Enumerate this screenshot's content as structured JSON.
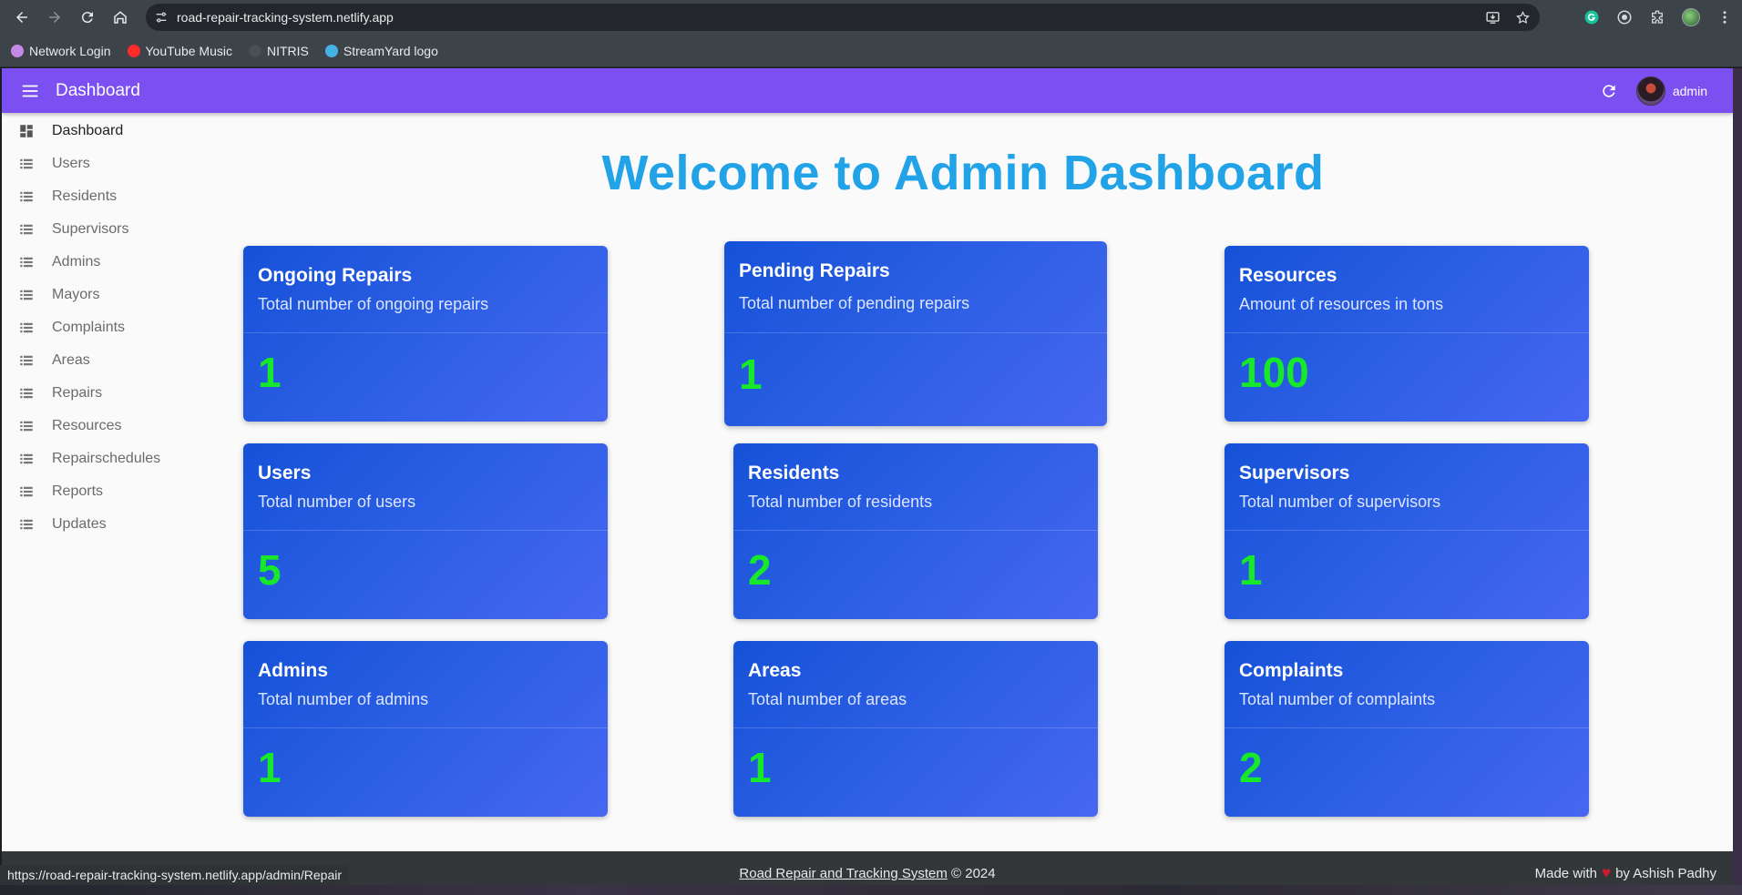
{
  "browser": {
    "url": "road-repair-tracking-system.netlify.app",
    "status_url": "https://road-repair-tracking-system.netlify.app/admin/Repair",
    "bookmarks": [
      {
        "label": "Network Login",
        "icon": "umbrella-icon",
        "color": "#c58ae8"
      },
      {
        "label": "YouTube Music",
        "icon": "youtube-music-icon",
        "color": "#ff2a2a"
      },
      {
        "label": "NITRIS",
        "icon": "nitris-icon",
        "color": "#4b4f55"
      },
      {
        "label": "StreamYard logo",
        "icon": "streamyard-icon",
        "color": "#46b3e6"
      }
    ]
  },
  "appbar": {
    "title": "Dashboard",
    "user": "admin",
    "color": "#7b4ff0"
  },
  "sidebar": {
    "items": [
      {
        "label": "Dashboard",
        "icon": "dashboard-icon"
      },
      {
        "label": "Users",
        "icon": "list-icon"
      },
      {
        "label": "Residents",
        "icon": "list-icon"
      },
      {
        "label": "Supervisors",
        "icon": "list-icon"
      },
      {
        "label": "Admins",
        "icon": "list-icon"
      },
      {
        "label": "Mayors",
        "icon": "list-icon"
      },
      {
        "label": "Complaints",
        "icon": "list-icon"
      },
      {
        "label": "Areas",
        "icon": "list-icon"
      },
      {
        "label": "Repairs",
        "icon": "list-icon"
      },
      {
        "label": "Resources",
        "icon": "list-icon"
      },
      {
        "label": "Repairschedules",
        "icon": "list-icon"
      },
      {
        "label": "Reports",
        "icon": "list-icon"
      },
      {
        "label": "Updates",
        "icon": "list-icon"
      }
    ]
  },
  "main": {
    "welcome": "Welcome to Admin Dashboard",
    "cards": [
      {
        "title": "Ongoing Repairs",
        "subtitle": "Total number of ongoing repairs",
        "value": "1"
      },
      {
        "title": "Pending Repairs",
        "subtitle": "Total number of pending repairs",
        "value": "1"
      },
      {
        "title": "Resources",
        "subtitle": "Amount of resources in tons",
        "value": "100"
      },
      {
        "title": "Users",
        "subtitle": "Total number of users",
        "value": "5"
      },
      {
        "title": "Residents",
        "subtitle": "Total number of residents",
        "value": "2"
      },
      {
        "title": "Supervisors",
        "subtitle": "Total number of supervisors",
        "value": "1"
      },
      {
        "title": "Admins",
        "subtitle": "Total number of admins",
        "value": "1"
      },
      {
        "title": "Areas",
        "subtitle": "Total number of areas",
        "value": "1"
      },
      {
        "title": "Complaints",
        "subtitle": "Total number of complaints",
        "value": "2"
      }
    ]
  },
  "footer": {
    "link": "Road Repair and Tracking System",
    "copyright": "© 2024",
    "made_prefix": "Made with",
    "made_suffix": "by Ashish Padhy"
  }
}
